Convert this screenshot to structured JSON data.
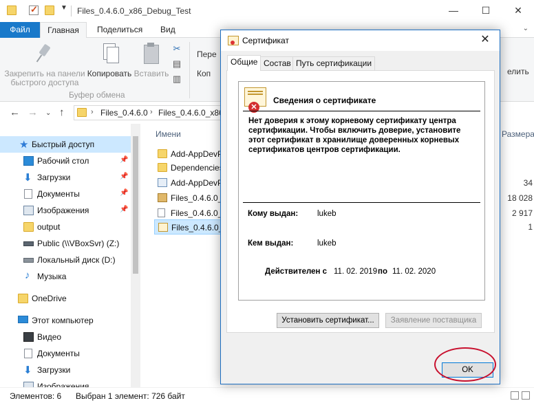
{
  "explorer": {
    "title": "Files_0.4.6.0_x86_Debug_Test",
    "ribbon_tabs": [
      "Файл",
      "Главная",
      "Поделиться",
      "Вид"
    ],
    "clipboard": {
      "pin_label_1": "Закрепить на панели",
      "pin_label_2": "быстрого доступа",
      "copy_label": "Копировать",
      "paste_label": "Вставить",
      "group_label": "Буфер обмена"
    },
    "ribbon_partial": {
      "move": "Пере",
      "copy_to": "Коп",
      "select": "елить"
    },
    "breadcrumb": [
      "Files_0.4.6.0",
      "Files_0.4.6.0_x86_"
    ],
    "nav_items": [
      {
        "label": "Быстрый доступ",
        "icon": "star-icon"
      },
      {
        "label": "Рабочий стол",
        "icon": "desktop-icon"
      },
      {
        "label": "Загрузки",
        "icon": "download-icon"
      },
      {
        "label": "Документы",
        "icon": "documents-icon"
      },
      {
        "label": "Изображения",
        "icon": "pictures-icon"
      },
      {
        "label": "output",
        "icon": "folder-icon"
      },
      {
        "label": "Public (\\\\VBoxSvr) (Z:)",
        "icon": "network-drive-icon"
      },
      {
        "label": "Локальный диск (D:)",
        "icon": "drive-icon"
      },
      {
        "label": "Музыка",
        "icon": "music-icon"
      },
      {
        "label": "OneDrive",
        "icon": "folder-icon"
      },
      {
        "label": "Этот компьютер",
        "icon": "computer-icon"
      },
      {
        "label": "Видео",
        "icon": "video-icon"
      },
      {
        "label": "Документы",
        "icon": "documents-icon"
      },
      {
        "label": "Загрузки",
        "icon": "download-icon"
      },
      {
        "label": "Изображения",
        "icon": "pictures-icon"
      }
    ],
    "columns": {
      "name": "Имени",
      "size": "Размера"
    },
    "files": [
      {
        "name": "Add-AppDevP",
        "icon": "folder-icon",
        "size": ""
      },
      {
        "name": "Dependencies",
        "icon": "folder-icon",
        "size": ""
      },
      {
        "name": "Add-AppDevP",
        "icon": "script-icon",
        "size": "34"
      },
      {
        "name": "Files_0.4.6.0_x",
        "icon": "package-icon",
        "size": "18 028"
      },
      {
        "name": "Files_0.4.6.0_x",
        "icon": "file-icon",
        "size": "2 917"
      },
      {
        "name": "Files_0.4.6.0_x",
        "icon": "certificate-icon",
        "size": "1"
      }
    ],
    "status": {
      "items": "Элементов: 6",
      "selected": "Выбран 1 элемент: 726 байт"
    }
  },
  "dialog": {
    "title": "Сертификат",
    "tabs": [
      "Общие",
      "Состав",
      "Путь сертификации"
    ],
    "info_title": "Сведения о сертификате",
    "warning": "Нет доверия к этому корневому сертификату центра сертификации. Чтобы включить  доверие, установите этот сертификат в хранилище доверенных корневых сертификатов центров сертификации.",
    "issued_to_label": "Кому выдан:",
    "issued_to": "lukeb",
    "issued_by_label": "Кем выдан:",
    "issued_by": "lukeb",
    "valid_label": "Действителен с",
    "valid_from": "11. 02. 2019",
    "valid_to_label": "по",
    "valid_to": "11. 02. 2020",
    "install_button": "Установить сертификат...",
    "issuer_statement_button": "Заявление поставщика",
    "ok_button": "OK"
  },
  "colors": {
    "accent": "#1979ca",
    "selection": "#cce8ff",
    "highlight_ring": "#c8102e"
  }
}
